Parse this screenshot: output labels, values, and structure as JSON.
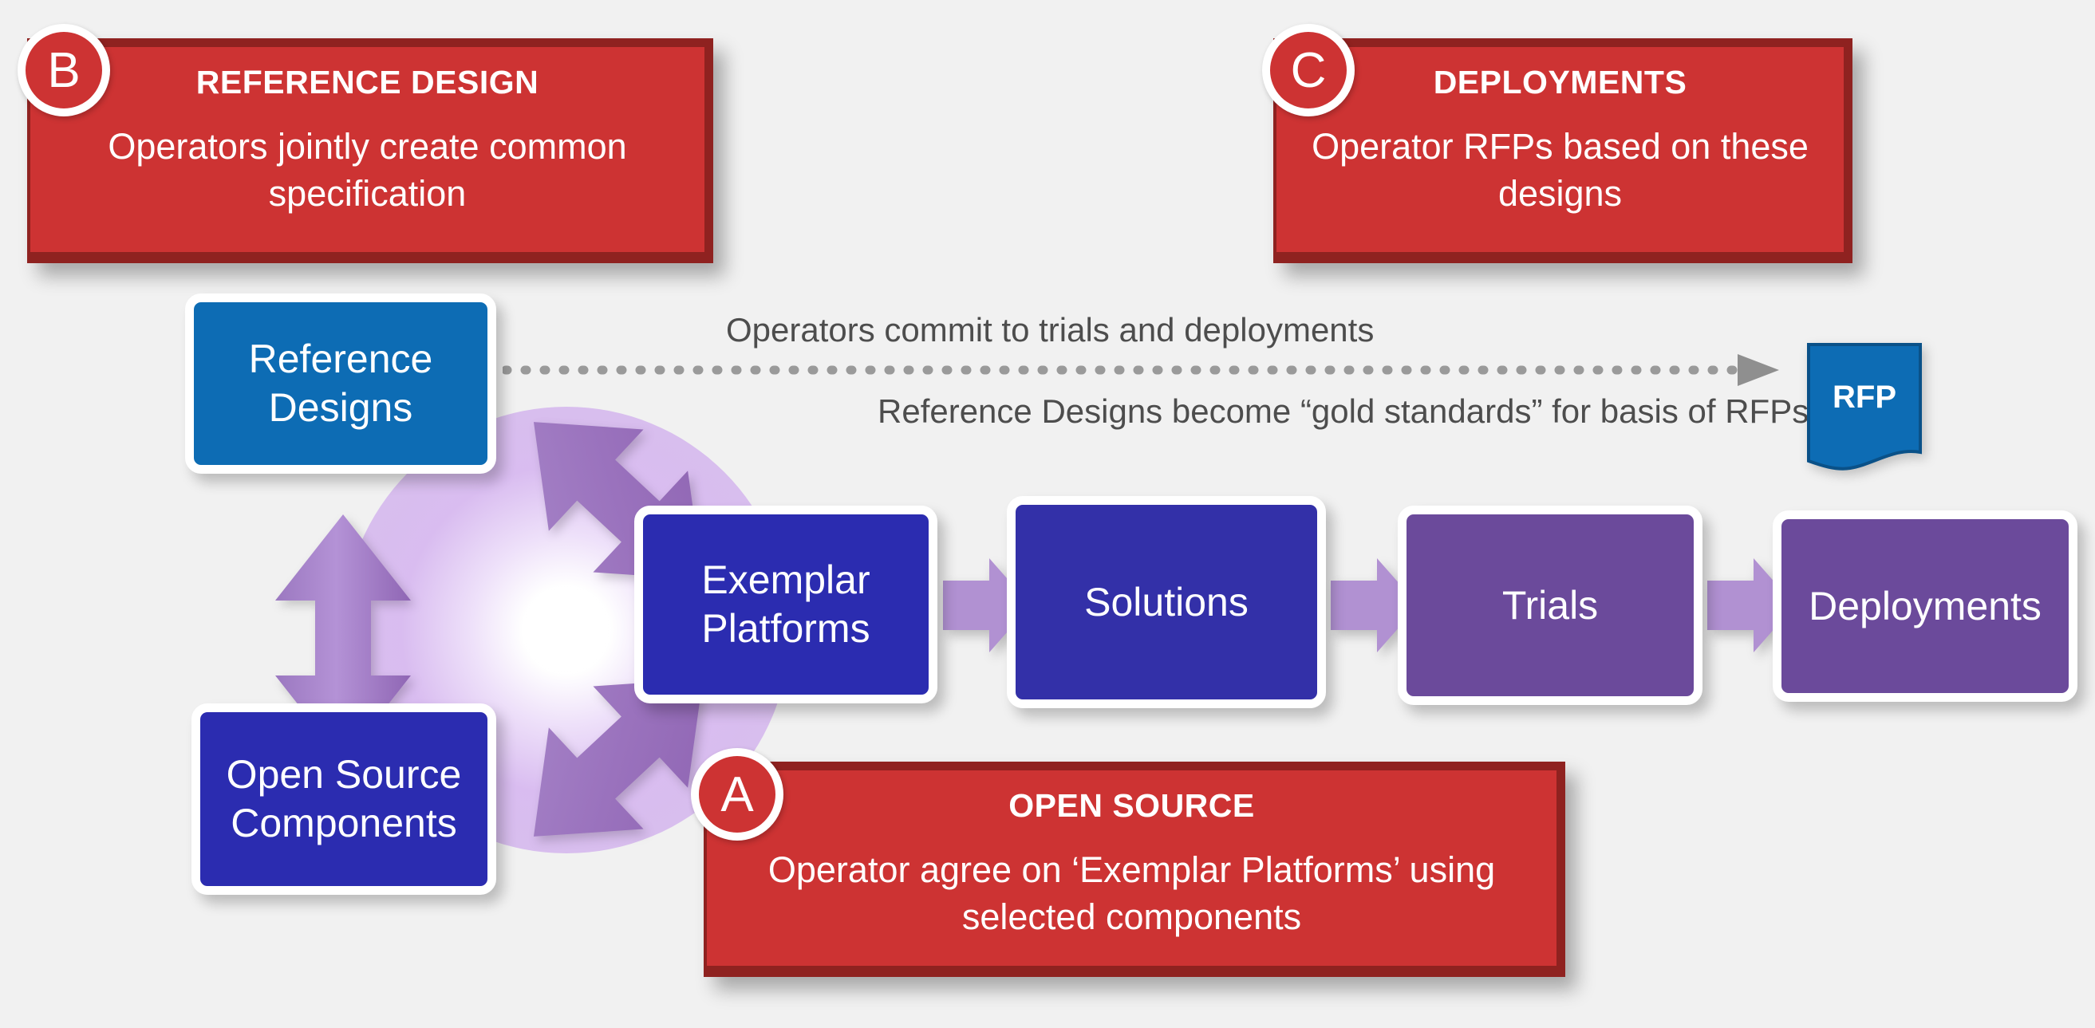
{
  "callouts": [
    {
      "id": "B",
      "badge": "B",
      "title": "REFERENCE DESIGN",
      "body": "Operators jointly create common specification"
    },
    {
      "id": "C",
      "badge": "C",
      "title": "DEPLOYMENTS",
      "body": "Operator RFPs based on these designs"
    },
    {
      "id": "A",
      "badge": "A",
      "title": "OPEN SOURCE",
      "body": "Operator agree on ‘Exemplar Platforms’ using selected components"
    }
  ],
  "sources": [
    {
      "label": "Reference Designs",
      "color": "#0d6cb4"
    },
    {
      "label": "Open Source Components",
      "color": "#2b2cb0"
    }
  ],
  "flow": [
    {
      "label": "Exemplar Platforms",
      "color": "#2b2cb0"
    },
    {
      "label": "Solutions",
      "color": "#3330a8"
    },
    {
      "label": "Trials",
      "color": "#6b4a9b"
    },
    {
      "label": "Deployments",
      "color": "#6b4a9b"
    }
  ],
  "notes": {
    "top": "Operators commit to trials and deployments",
    "bottom": "Reference Designs become “gold standards” for basis of RFPs"
  },
  "rfp": {
    "label": "RFP",
    "color": "#0d6cb4"
  },
  "colors": {
    "background": "#f1f1f1",
    "callout_fill": "#cd3333",
    "callout_border": "#8f2220",
    "chevron": "#b191d2",
    "glow": "#cea9ec",
    "note_text": "#4d4d4d",
    "dotted_line": "#9a9a9a"
  }
}
